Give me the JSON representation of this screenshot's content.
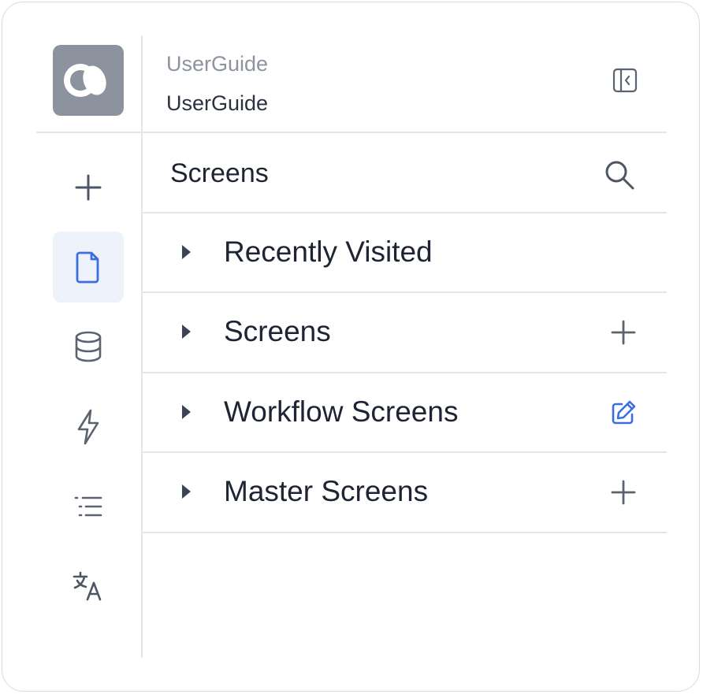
{
  "app": {
    "subtitle": "UserGuide",
    "name": "UserGuide",
    "logo_icon": "app-logo-icon",
    "collapse_icon": "sidebar-collapse-icon"
  },
  "rail": {
    "items": [
      {
        "icon": "plus-icon",
        "active": false
      },
      {
        "icon": "file-icon",
        "active": true
      },
      {
        "icon": "database-icon",
        "active": false
      },
      {
        "icon": "lightning-icon",
        "active": false
      },
      {
        "icon": "list-icon",
        "active": false
      },
      {
        "icon": "translate-icon",
        "active": false
      }
    ]
  },
  "panel": {
    "title": "Screens",
    "search_icon": "search-icon",
    "sections": [
      {
        "label": "Recently Visited",
        "action_icon": ""
      },
      {
        "label": "Screens",
        "action_icon": "plus-icon"
      },
      {
        "label": "Workflow Screens",
        "action_icon": "edit-icon"
      },
      {
        "label": "Master Screens",
        "action_icon": "plus-icon"
      }
    ]
  },
  "colors": {
    "accent": "#3b6fe0",
    "active_bg": "#eef2fb",
    "icon": "#5b6270",
    "divider": "#e3e5ea",
    "logo_bg": "#8c939e"
  }
}
